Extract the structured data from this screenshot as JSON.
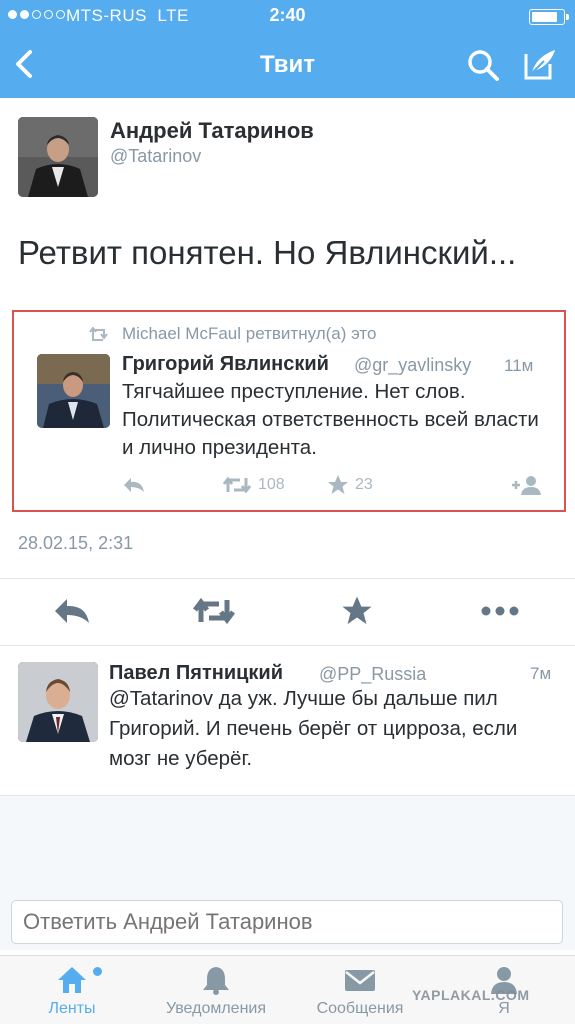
{
  "status_bar": {
    "carrier": "MTS-RUS",
    "network": "LTE",
    "time": "2:40",
    "battery_level": 0.85
  },
  "nav": {
    "title": "Твит",
    "back_icon": "chevron-left-icon",
    "search_icon": "search-icon",
    "compose_icon": "compose-icon"
  },
  "tweet": {
    "author_name": "Андрей Татаринов",
    "author_handle": "@Tatarinov",
    "text": "Ретвит понятен. Но Явлинский...",
    "timestamp": "28.02.15, 2:31"
  },
  "quoted": {
    "context": "Michael McFaul ретвитнул(а) это",
    "name": "Григорий Явлинский",
    "handle": "@gr_yavlinsky",
    "time": "11м",
    "text": "Тягчайшее преступление. Нет слов. Политическая ответственность всей власти и лично президента.",
    "retweets": "108",
    "favorites": "23"
  },
  "reply": {
    "name": "Павел Пятницкий",
    "handle": "@PP_Russia",
    "time": "7м",
    "text": "@Tatarinov да уж. Лучше бы дальше пил Григорий. И печень берёг от цирроза, если мозг не уберёг."
  },
  "reply_input": {
    "placeholder": "Ответить Андрей Татаринов"
  },
  "tabs": [
    {
      "label": "Ленты",
      "icon": "home-icon"
    },
    {
      "label": "Уведомления",
      "icon": "bell-icon"
    },
    {
      "label": "Сообщения",
      "icon": "envelope-icon"
    },
    {
      "label": "Я",
      "icon": "person-icon"
    }
  ],
  "watermark": "YAPLAKAL.COM",
  "colors": {
    "brand": "#55acee",
    "text": "#292f33",
    "muted": "#8899a6",
    "highlight_border": "#d9544f"
  }
}
